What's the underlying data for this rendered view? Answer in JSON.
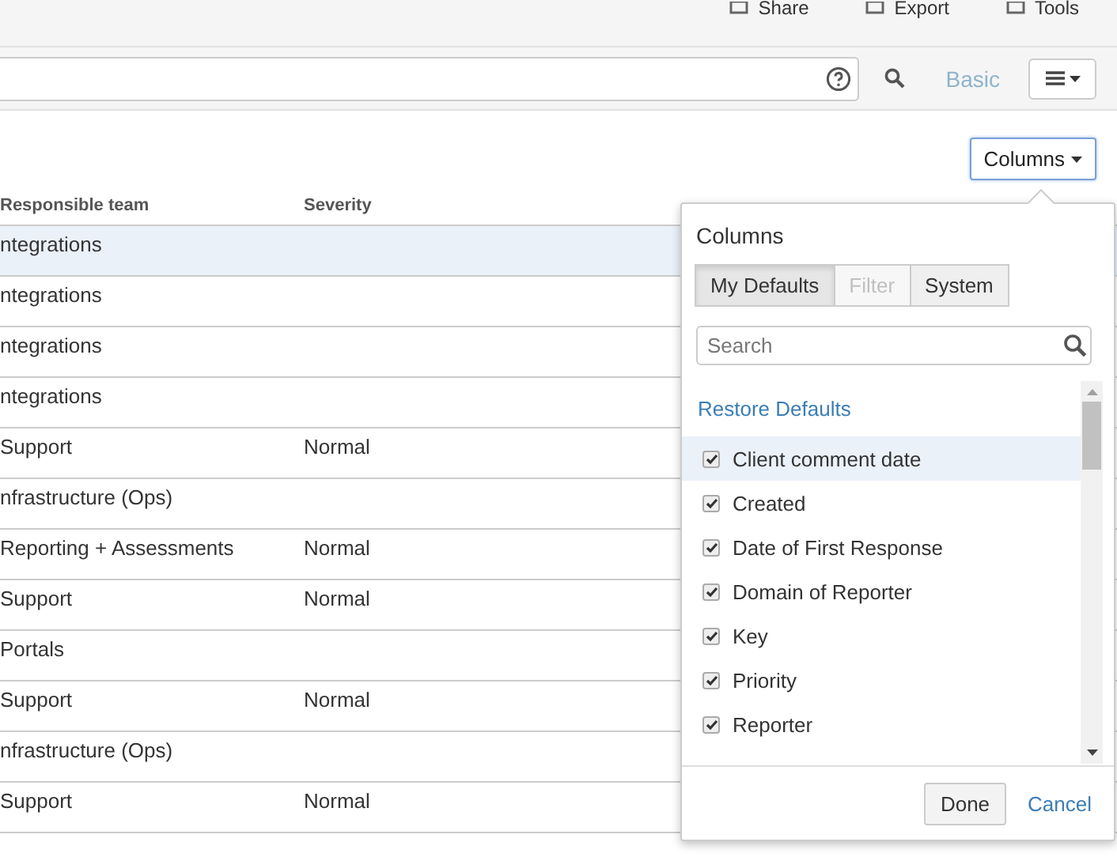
{
  "top_bar": {
    "actions": [
      "Share",
      "Export",
      "Tools"
    ]
  },
  "search_bar": {
    "mode_link": "Basic"
  },
  "columns_button": {
    "label": "Columns"
  },
  "table": {
    "columns": [
      "Responsible team",
      "Severity"
    ],
    "rows": [
      {
        "cells": [
          "ntegrations",
          ""
        ],
        "selected": true
      },
      {
        "cells": [
          "ntegrations",
          ""
        ],
        "selected": false
      },
      {
        "cells": [
          "ntegrations",
          ""
        ],
        "selected": false
      },
      {
        "cells": [
          "ntegrations",
          ""
        ],
        "selected": false
      },
      {
        "cells": [
          "Support",
          "Normal"
        ],
        "selected": false
      },
      {
        "cells": [
          "nfrastructure (Ops)",
          ""
        ],
        "selected": false
      },
      {
        "cells": [
          "Reporting + Assessments",
          "Normal"
        ],
        "selected": false
      },
      {
        "cells": [
          "Support",
          "Normal"
        ],
        "selected": false
      },
      {
        "cells": [
          "Portals",
          ""
        ],
        "selected": false
      },
      {
        "cells": [
          "Support",
          "Normal"
        ],
        "selected": false
      },
      {
        "cells": [
          "nfrastructure (Ops)",
          ""
        ],
        "selected": false
      },
      {
        "cells": [
          "Support",
          "Normal"
        ],
        "selected": false
      }
    ]
  },
  "columns_popup": {
    "title": "Columns",
    "tabs": [
      {
        "label": "My Defaults",
        "selected": true,
        "disabled": false
      },
      {
        "label": "Filter",
        "selected": false,
        "disabled": true
      },
      {
        "label": "System",
        "selected": false,
        "disabled": false
      }
    ],
    "search": {
      "placeholder": "Search"
    },
    "restore_link": "Restore Defaults",
    "items": [
      {
        "label": "Client comment date",
        "checked": true,
        "selected": true
      },
      {
        "label": "Created",
        "checked": true,
        "selected": false
      },
      {
        "label": "Date of First Response",
        "checked": true,
        "selected": false
      },
      {
        "label": "Domain of Reporter",
        "checked": true,
        "selected": false
      },
      {
        "label": "Key",
        "checked": true,
        "selected": false
      },
      {
        "label": "Priority",
        "checked": true,
        "selected": false
      },
      {
        "label": "Reporter",
        "checked": true,
        "selected": false
      }
    ],
    "buttons": {
      "done": "Done",
      "cancel": "Cancel"
    }
  }
}
